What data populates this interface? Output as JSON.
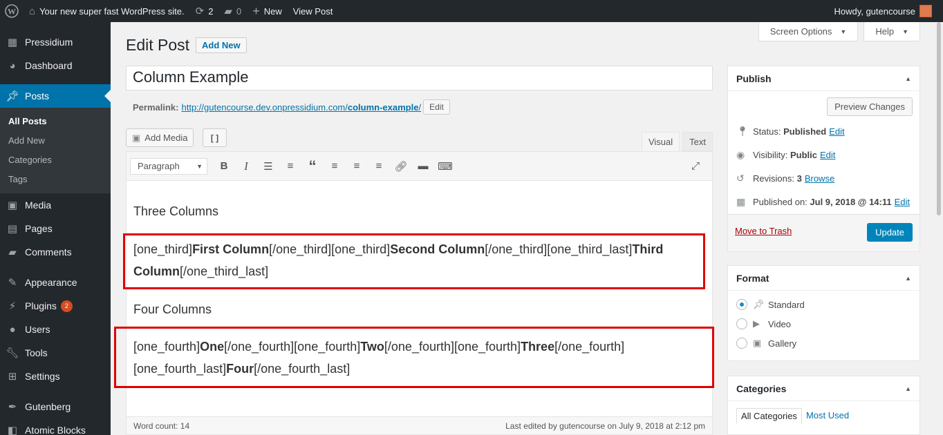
{
  "adminbar": {
    "site_name": "Your new super fast WordPress site.",
    "updates": "2",
    "comments": "0",
    "new_label": "New",
    "view_post": "View Post",
    "howdy": "Howdy, gutencourse"
  },
  "sidebar": {
    "items": [
      {
        "label": "Pressidium",
        "icon": "cube-icon"
      },
      {
        "label": "Dashboard",
        "icon": "dashboard-icon"
      },
      {
        "label": "Posts",
        "icon": "pin-icon"
      },
      {
        "label": "Media",
        "icon": "media-icon"
      },
      {
        "label": "Pages",
        "icon": "pages-icon"
      },
      {
        "label": "Comments",
        "icon": "comments-icon"
      },
      {
        "label": "Appearance",
        "icon": "brush-icon"
      },
      {
        "label": "Plugins",
        "icon": "plugin-icon",
        "badge": "2"
      },
      {
        "label": "Users",
        "icon": "user-icon"
      },
      {
        "label": "Tools",
        "icon": "wrench-icon"
      },
      {
        "label": "Settings",
        "icon": "settings-icon"
      },
      {
        "label": "Gutenberg",
        "icon": "pen-icon"
      },
      {
        "label": "Atomic Blocks",
        "icon": "block-icon"
      }
    ],
    "posts_submenu": [
      "All Posts",
      "Add New",
      "Categories",
      "Tags"
    ]
  },
  "header": {
    "screen_options": "Screen Options",
    "help": "Help",
    "title": "Edit Post",
    "add_new": "Add New"
  },
  "post": {
    "title": "Column Example",
    "permalink_label": "Permalink:",
    "permalink_base": "http://gutencourse.dev.onpressidium.com/",
    "permalink_slug": "column-example",
    "permalink_trail": "/",
    "edit": "Edit"
  },
  "editor": {
    "add_media": "Add Media",
    "shortcode_btn": "[ ]",
    "tab_visual": "Visual",
    "tab_text": "Text",
    "format": "Paragraph",
    "heading1": "Three Columns",
    "para1": {
      "t1": "[one_third]",
      "b1": "First Column",
      "t2": "[/one_third][one_third]",
      "b2": "Second Column",
      "t3": "[/one_third][one_third_last]",
      "b3": "Third Column",
      "t4": "[/one_third_last]"
    },
    "heading2": "Four Columns",
    "para2": {
      "t1": "[one_fourth]",
      "b1": "One",
      "t2": "[/one_fourth][one_fourth]",
      "b2": "Two",
      "t3": "[/one_fourth][one_fourth]",
      "b3": "Three",
      "t4": "[/one_fourth]",
      "t5": "[one_fourth_last]",
      "b4": "Four",
      "t6": "[/one_fourth_last]"
    },
    "word_count": "Word count: 14",
    "last_edited": "Last edited by gutencourse on July 9, 2018 at 2:12 pm"
  },
  "publish": {
    "title": "Publish",
    "preview": "Preview Changes",
    "status_label": "Status:",
    "status_value": "Published",
    "status_edit": "Edit",
    "visibility_label": "Visibility:",
    "visibility_value": "Public",
    "visibility_edit": "Edit",
    "revisions_label": "Revisions:",
    "revisions_value": "3",
    "revisions_browse": "Browse",
    "published_label": "Published on:",
    "published_value": "Jul 9, 2018 @ 14:11",
    "published_edit": "Edit",
    "trash": "Move to Trash",
    "update": "Update"
  },
  "format_box": {
    "title": "Format",
    "options": [
      "Standard",
      "Video",
      "Gallery"
    ],
    "selected": "Standard"
  },
  "categories_box": {
    "title": "Categories",
    "tab_all": "All Categories",
    "tab_used": "Most Used"
  },
  "colors": {
    "accent": "#0073aa",
    "adminbar_bg": "#23282d",
    "highlight_box": "#e00000",
    "update_btn": "#0085ba"
  }
}
